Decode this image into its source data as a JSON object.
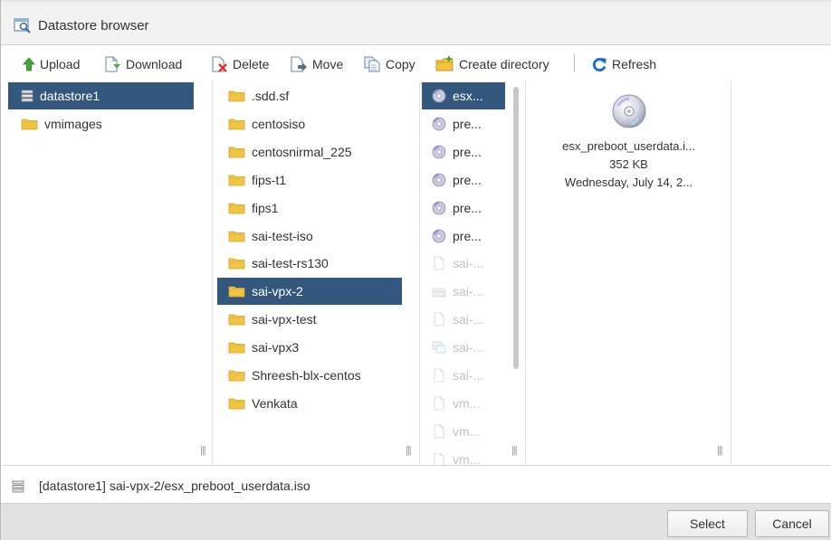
{
  "window": {
    "title": "Datastore browser"
  },
  "toolbar": {
    "upload": "Upload",
    "download": "Download",
    "delete": "Delete",
    "move": "Move",
    "copy": "Copy",
    "create_directory": "Create directory",
    "refresh": "Refresh"
  },
  "datastores": [
    {
      "label": "datastore1",
      "icon": "datastore-icon",
      "selected": true
    },
    {
      "label": "vmimages",
      "icon": "folder-icon",
      "selected": false
    }
  ],
  "folders": [
    {
      "label": ".sdd.sf"
    },
    {
      "label": "centosiso"
    },
    {
      "label": "centosnirmal_225"
    },
    {
      "label": "fips-t1"
    },
    {
      "label": "fips1"
    },
    {
      "label": "sai-test-iso"
    },
    {
      "label": "sai-test-rs130"
    },
    {
      "label": "sai-vpx-2",
      "selected": true
    },
    {
      "label": "sai-vpx-test"
    },
    {
      "label": "sai-vpx3"
    },
    {
      "label": "Shreesh-blx-centos"
    },
    {
      "label": "Venkata"
    }
  ],
  "files": [
    {
      "label": "esx...",
      "icon": "disc-icon",
      "selected": true
    },
    {
      "label": "pre...",
      "icon": "disc-icon"
    },
    {
      "label": "pre...",
      "icon": "disc-icon"
    },
    {
      "label": "pre...",
      "icon": "disc-icon"
    },
    {
      "label": "pre...",
      "icon": "disc-icon"
    },
    {
      "label": "pre...",
      "icon": "disc-icon"
    },
    {
      "label": "sai-...",
      "icon": "file-icon",
      "dim": true
    },
    {
      "label": "sai-...",
      "icon": "disk-icon",
      "dim": true
    },
    {
      "label": "sai-...",
      "icon": "file-icon",
      "dim": true
    },
    {
      "label": "sai-...",
      "icon": "vm-icon",
      "dim": true
    },
    {
      "label": "sai-...",
      "icon": "file-icon",
      "dim": true
    },
    {
      "label": "vm...",
      "icon": "file-icon",
      "dim": true
    },
    {
      "label": "vm...",
      "icon": "file-icon",
      "dim": true
    },
    {
      "label": "vm...",
      "icon": "file-icon",
      "dim": true
    }
  ],
  "details": {
    "name": "esx_preboot_userdata.i...",
    "size": "352 KB",
    "modified": "Wednesday, July 14, 2..."
  },
  "path": "[datastore1] sai-vpx-2/esx_preboot_userdata.iso",
  "buttons": {
    "select": "Select",
    "cancel": "Cancel"
  },
  "colors": {
    "selection": "#34577d",
    "folder": "#f2c443",
    "refresh": "#1f6fc5",
    "upload": "#3fa535"
  }
}
